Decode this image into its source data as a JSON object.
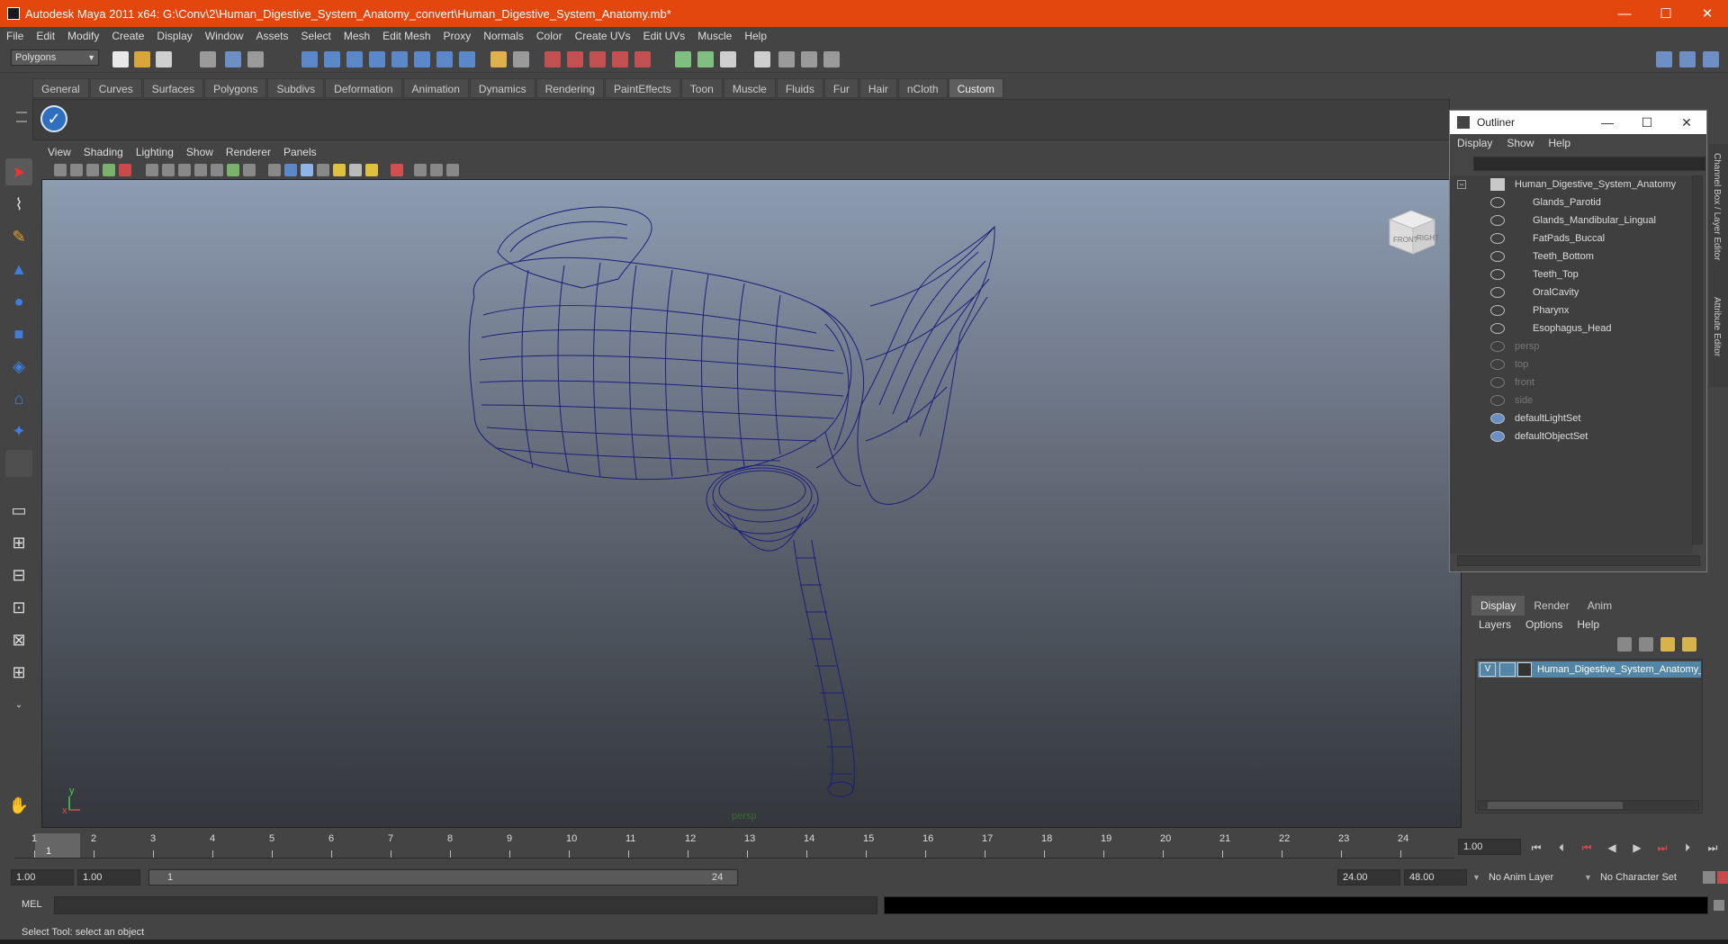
{
  "window": {
    "title": "Autodesk Maya 2011 x64: G:\\Conv\\2\\Human_Digestive_System_Anatomy_convert\\Human_Digestive_System_Anatomy.mb*",
    "minimize": "—",
    "maximize": "☐",
    "close": "✕"
  },
  "menubar": [
    "File",
    "Edit",
    "Modify",
    "Create",
    "Display",
    "Window",
    "Assets",
    "Select",
    "Mesh",
    "Edit Mesh",
    "Proxy",
    "Normals",
    "Color",
    "Create UVs",
    "Edit UVs",
    "Muscle",
    "Help"
  ],
  "status_line": {
    "mode": "Polygons"
  },
  "shelf": {
    "tabs": [
      "General",
      "Curves",
      "Surfaces",
      "Polygons",
      "Subdivs",
      "Deformation",
      "Animation",
      "Dynamics",
      "Rendering",
      "PaintEffects",
      "Toon",
      "Muscle",
      "Fluids",
      "Fur",
      "Hair",
      "nCloth",
      "Custom"
    ],
    "active_tab": "Custom"
  },
  "panel": {
    "menus": [
      "View",
      "Shading",
      "Lighting",
      "Show",
      "Renderer",
      "Panels"
    ],
    "camera_label": "persp",
    "viewcube": {
      "front": "FRONT",
      "right": "RIGHT"
    },
    "axis": {
      "x": "x",
      "y": "y"
    }
  },
  "outliner": {
    "title": "Outliner",
    "menus": [
      "Display",
      "Show",
      "Help"
    ],
    "items": [
      {
        "label": "Human_Digestive_System_Anatomy",
        "level": 0,
        "dim": false
      },
      {
        "label": "Glands_Parotid",
        "level": 1,
        "dim": false
      },
      {
        "label": "Glands_Mandibular_Lingual",
        "level": 1,
        "dim": false
      },
      {
        "label": "FatPads_Buccal",
        "level": 1,
        "dim": false
      },
      {
        "label": "Teeth_Bottom",
        "level": 1,
        "dim": false
      },
      {
        "label": "Teeth_Top",
        "level": 1,
        "dim": false
      },
      {
        "label": "OralCavity",
        "level": 1,
        "dim": false
      },
      {
        "label": "Pharynx",
        "level": 1,
        "dim": false
      },
      {
        "label": "Esophagus_Head",
        "level": 1,
        "dim": false
      },
      {
        "label": "persp",
        "level": 0,
        "dim": true
      },
      {
        "label": "top",
        "level": 0,
        "dim": true
      },
      {
        "label": "front",
        "level": 0,
        "dim": true
      },
      {
        "label": "side",
        "level": 0,
        "dim": true
      },
      {
        "label": "defaultLightSet",
        "level": 0,
        "dim": false
      },
      {
        "label": "defaultObjectSet",
        "level": 0,
        "dim": false
      }
    ]
  },
  "side_tabs": [
    "Channel Box / Layer Editor",
    "Attribute Editor"
  ],
  "layer_editor": {
    "tabs": [
      "Display",
      "Render",
      "Anim"
    ],
    "active_tab": "Display",
    "menus": [
      "Layers",
      "Options",
      "Help"
    ],
    "layer": {
      "visible": "V",
      "name": "Human_Digestive_System_Anatomy_"
    }
  },
  "time_slider": {
    "ticks": [
      "1",
      "2",
      "3",
      "4",
      "5",
      "6",
      "7",
      "8",
      "9",
      "10",
      "11",
      "12",
      "13",
      "14",
      "15",
      "16",
      "17",
      "18",
      "19",
      "20",
      "21",
      "22",
      "23",
      "24"
    ],
    "current_frame_marker": "1",
    "current_time": "1.00"
  },
  "range_slider": {
    "start_time": "1.00",
    "playback_start": "1.00",
    "range_start_label": "1",
    "range_end_label": "24",
    "playback_end": "24.00",
    "end_time": "48.00",
    "anim_layer": "No Anim Layer",
    "character_set": "No Character Set"
  },
  "command_line": {
    "label": "MEL"
  },
  "help_line": "Select Tool: select an object",
  "colors": {
    "title_bar": "#e3470e",
    "wireframe": "#1c1f7a",
    "layer_selected": "#5285a6"
  }
}
